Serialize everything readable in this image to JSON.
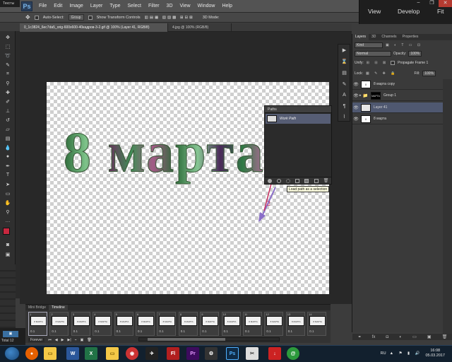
{
  "app": {
    "logo": "Ps",
    "window_title": "Тексты"
  },
  "menu": [
    "File",
    "Edit",
    "Image",
    "Layer",
    "Type",
    "Select",
    "Filter",
    "3D",
    "View",
    "Window",
    "Help"
  ],
  "options": {
    "auto_select": "Auto-Select:",
    "auto_select_mode": "Group",
    "show_transform": "Show Transform Controls",
    "mode_3d": "3D Mode:"
  },
  "lightroom": {
    "view": "View",
    "develop": "Develop",
    "fit": "Fit"
  },
  "doc_tabs": [
    "0_1c3824_6ec7da5_orig-600x600-40кадров-3-2.gif @ 100% (Layer 41, RGB/8)",
    "4.jpg @ 100% (RGB/8)"
  ],
  "canvas": {
    "art_text": "8 марта",
    "arrow_label_1": "1",
    "arrow_label_2": "2"
  },
  "paths_panel": {
    "title": "Paths",
    "item": "Work Path",
    "tooltip": "Load path as a selection"
  },
  "layers_panel": {
    "tabs": [
      "Layers",
      "3D",
      "Channels",
      "Properties"
    ],
    "kind": "Kind",
    "blend": "Normal",
    "opacity_label": "Opacity:",
    "opacity": "100%",
    "unify": "Unify:",
    "propagate": "Propagate Frame 1",
    "lock": "Lock:",
    "fill_label": "Fill:",
    "fill": "100%",
    "layers": [
      {
        "name": "8 марта copy",
        "thumb": "8 МАРТА"
      },
      {
        "name": "Group 1",
        "thumb": "МАРТА"
      },
      {
        "name": "Layer 41",
        "thumb": ""
      },
      {
        "name": "8 марта",
        "thumb": "8 МАРТА"
      }
    ]
  },
  "timeline": {
    "tabs": [
      "Mini Bridge",
      "Timeline"
    ],
    "frames": [
      {
        "num": "1",
        "delay": "0.1"
      },
      {
        "num": "2",
        "delay": "0.1"
      },
      {
        "num": "3",
        "delay": "0.1"
      },
      {
        "num": "4",
        "delay": "0.1"
      },
      {
        "num": "5",
        "delay": "0.1"
      },
      {
        "num": "6",
        "delay": "0.1"
      },
      {
        "num": "7",
        "delay": "0.1"
      },
      {
        "num": "8",
        "delay": "0.1"
      },
      {
        "num": "9",
        "delay": "0.1"
      },
      {
        "num": "10",
        "delay": "0.1"
      },
      {
        "num": "11",
        "delay": "0.1"
      },
      {
        "num": "12",
        "delay": "0.1"
      },
      {
        "num": "13",
        "delay": "0.1"
      },
      {
        "num": "14",
        "delay": "0.1"
      }
    ],
    "frame_thumb": "8 МАРТА",
    "loop": "Forever"
  },
  "status": {
    "total": "Total 12"
  },
  "taskbar": {
    "lang": "RU",
    "time": "16:08",
    "date": "05.03.2017"
  },
  "colors": {
    "foreground": "#c8283f",
    "background": "#ffffff",
    "accent": "#4f5870"
  }
}
